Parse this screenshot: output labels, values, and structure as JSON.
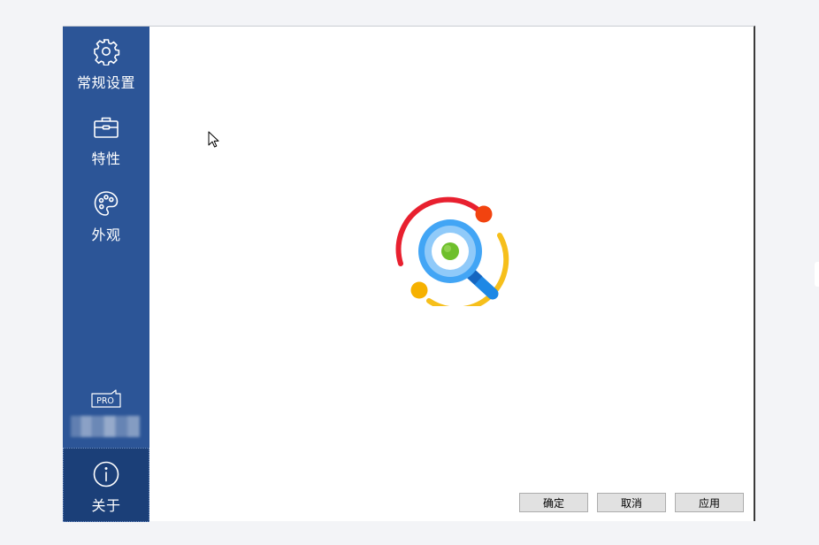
{
  "sidebar": {
    "items": [
      {
        "label": "常规设置",
        "icon": "gear-icon"
      },
      {
        "label": "特性",
        "icon": "toolbox-icon"
      },
      {
        "label": "外观",
        "icon": "palette-icon"
      }
    ],
    "pro_badge": "PRO",
    "about": {
      "label": "关于",
      "icon": "info-icon"
    }
  },
  "footer": {
    "ok_label": "确定",
    "cancel_label": "取消",
    "apply_label": "应用"
  },
  "colors": {
    "sidebar_bg": "#2c5597",
    "sidebar_active_bg": "#1b3f78",
    "logo_red": "#e8202f",
    "logo_yellow": "#f6bf1b",
    "logo_blue": "#42a5f5",
    "logo_green": "#6ebf2c"
  }
}
